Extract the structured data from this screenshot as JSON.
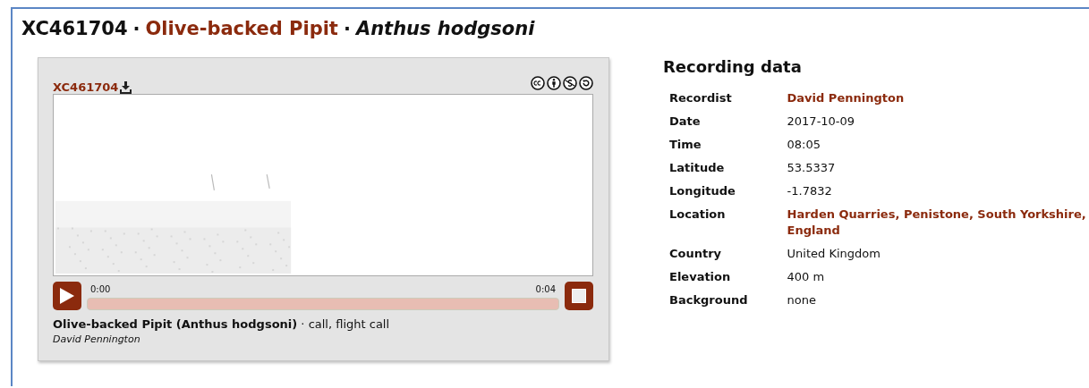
{
  "title": {
    "parts": [
      {
        "kind": "id",
        "text": "XC461704"
      },
      {
        "kind": "separator",
        "text": "·"
      },
      {
        "kind": "link",
        "text": "Olive-backed Pipit"
      },
      {
        "kind": "separator",
        "text": "·"
      },
      {
        "kind": "scientific",
        "text": "Anthus hodgsoni"
      }
    ]
  },
  "player": {
    "catalogue_link": "XC461704",
    "time_start": "0:00",
    "time_end": "0:04",
    "caption": "**Olive-backed Pipit (Anthus hodgsoni)** · call, flight call",
    "recordist": "David Pennington"
  },
  "recording_data": {
    "heading": "Recording data",
    "rows": [
      {
        "label": "Recordist",
        "value": "David Pennington",
        "kind": "link"
      },
      {
        "label": "Date",
        "value": "2017-10-09",
        "kind": "text"
      },
      {
        "label": "Time",
        "value": "08:05",
        "kind": "text"
      },
      {
        "label": "Latitude",
        "value": "53.5337",
        "kind": "text"
      },
      {
        "label": "Longitude",
        "value": "-1.7832",
        "kind": "text"
      },
      {
        "label": "Location",
        "value": "Harden Quarries, Penistone, South Yorkshire, England",
        "kind": "link"
      },
      {
        "label": "Country",
        "value": "United Kingdom",
        "kind": "text"
      },
      {
        "label": "Elevation",
        "value": "400 m",
        "kind": "text"
      },
      {
        "label": "Background",
        "value": "none",
        "kind": "text"
      }
    ]
  }
}
